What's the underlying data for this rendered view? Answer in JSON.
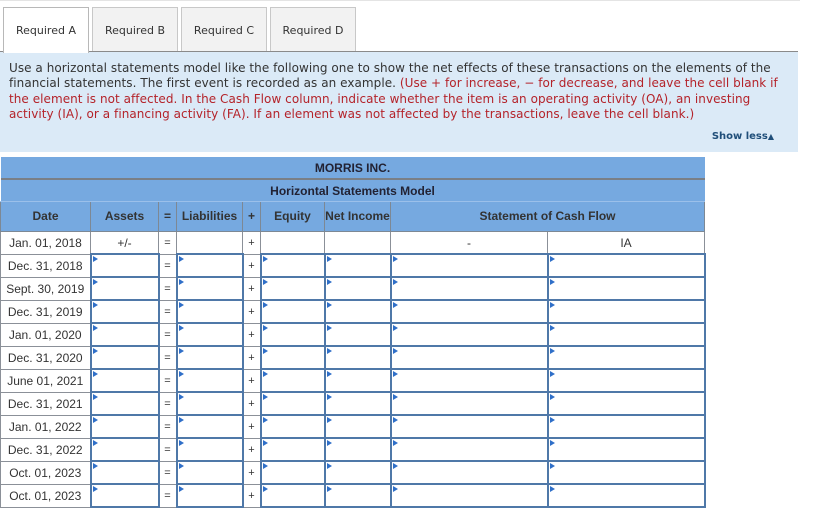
{
  "tabs": [
    {
      "label": "Required A",
      "active": true
    },
    {
      "label": "Required B",
      "active": false
    },
    {
      "label": "Required C",
      "active": false
    },
    {
      "label": "Required D",
      "active": false
    }
  ],
  "instructions": {
    "text": "Use a horizontal statements model like the following one to show the net effects of these transactions on the elements of the financial statements. The first event is recorded as an example. ",
    "red_text": "(Use + for increase, − for decrease, and leave the cell blank if the element is not affected. In the Cash Flow column, indicate whether the item is an operating activity (OA), an investing activity (IA), or a financing activity (FA). If an element was not affected by the transactions, leave the cell blank.)",
    "show_less_label": "Show less",
    "show_less_icon": "▲"
  },
  "table": {
    "company": "MORRIS INC.",
    "title": "Horizontal Statements Model",
    "headers": {
      "date": "Date",
      "assets": "Assets",
      "eq": "=",
      "liabilities": "Liabilities",
      "plus": "+",
      "equity": "Equity",
      "net_income": "Net Income",
      "cash_flow": "Statement of Cash Flow"
    },
    "example_row": {
      "date": "Jan. 01, 2018",
      "assets": "+/-",
      "eq": "=",
      "liabilities": "",
      "plus": "+",
      "equity": "",
      "net_income": "",
      "cash_flow_amount": "-",
      "cash_flow_type": "IA"
    },
    "rows": [
      {
        "date": "Dec. 31, 2018"
      },
      {
        "date": "Sept. 30, 2019"
      },
      {
        "date": "Dec. 31, 2019"
      },
      {
        "date": "Jan. 01, 2020"
      },
      {
        "date": "Dec. 31, 2020"
      },
      {
        "date": "June 01, 2021"
      },
      {
        "date": "Dec. 31, 2021"
      },
      {
        "date": "Jan. 01, 2022"
      },
      {
        "date": "Dec. 31, 2022"
      },
      {
        "date": "Oct. 01, 2023"
      },
      {
        "date": "Oct. 01, 2023"
      }
    ],
    "eq_symbol": "=",
    "plus_symbol": "+"
  }
}
